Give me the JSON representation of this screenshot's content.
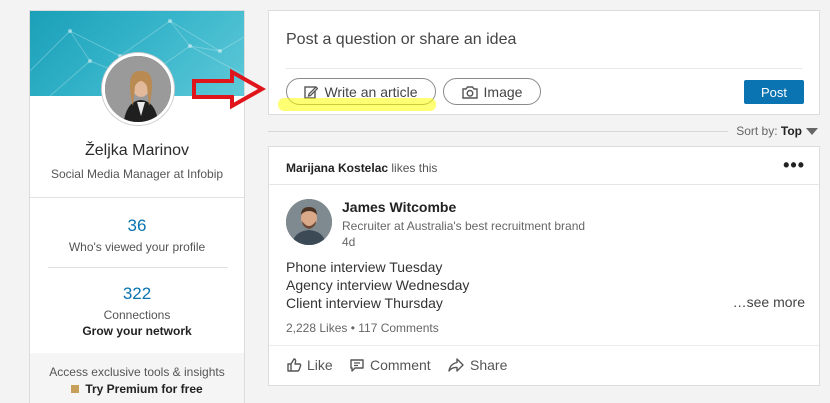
{
  "profile": {
    "name": "Željka Marinov",
    "title": "Social Media Manager at Infobip",
    "views_count": "36",
    "views_label": "Who's viewed your profile",
    "connections_count": "322",
    "connections_label": "Connections",
    "grow_network": "Grow your network",
    "premium_text": "Access exclusive tools & insights",
    "premium_link": "Try Premium for free"
  },
  "share": {
    "prompt": "Post a question or share an idea",
    "article_label": "Write an article",
    "image_label": "Image",
    "post_label": "Post"
  },
  "sort": {
    "label": "Sort by:",
    "value": "Top"
  },
  "feed": {
    "liker": "Marijana Kostelac",
    "liker_suffix": "likes this",
    "author_name": "James Witcombe",
    "author_title": "Recruiter at Australia's best recruitment brand",
    "author_time": "4d",
    "lines": [
      "Phone interview Tuesday",
      "Agency interview Wednesday",
      "Client interview Thursday"
    ],
    "see_more": "…see more",
    "stats": "2,228 Likes • 117 Comments",
    "actions": {
      "like": "Like",
      "comment": "Comment",
      "share": "Share"
    }
  },
  "colors": {
    "accent": "#0a73b1",
    "arrow": "#e0141b",
    "highlight": "#ffff00"
  }
}
